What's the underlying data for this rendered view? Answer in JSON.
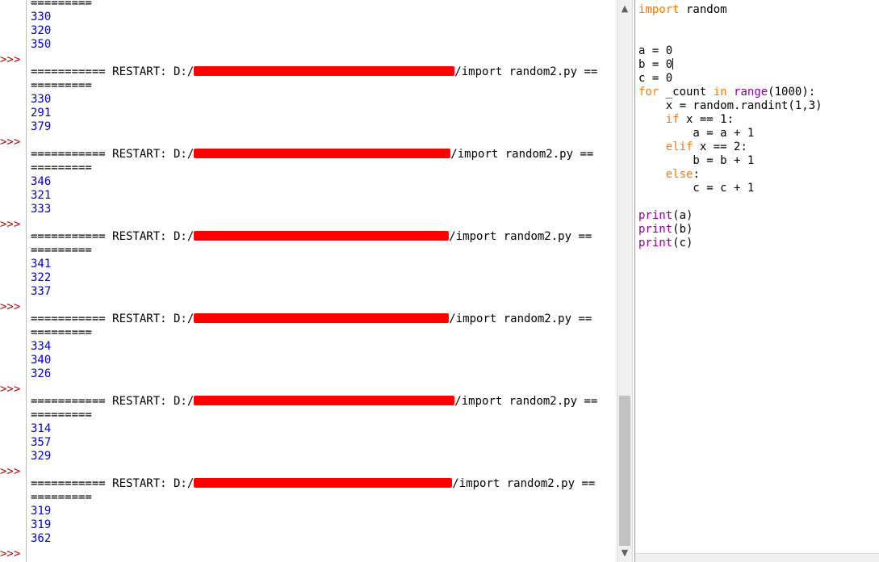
{
  "shell": {
    "prompt": ">>>",
    "top_partial": "=========",
    "first_outputs": [
      "330",
      "320",
      "350"
    ],
    "restart_line": "=========== RESTART: D:/",
    "restart_suffix": "/import random2.py ==",
    "restart_cont": "=========",
    "runs": [
      {
        "outputs": [
          "330",
          "291",
          "379"
        ]
      },
      {
        "outputs": [
          "346",
          "321",
          "333"
        ]
      },
      {
        "outputs": [
          "341",
          "322",
          "337"
        ]
      },
      {
        "outputs": [
          "334",
          "340",
          "326"
        ]
      },
      {
        "outputs": [
          "314",
          "357",
          "329"
        ]
      },
      {
        "outputs": [
          "319",
          "319",
          "362"
        ]
      }
    ]
  },
  "editor": {
    "lines": [
      {
        "kw": "import",
        "rest": " random"
      },
      {
        "rest": ""
      },
      {
        "rest": ""
      },
      {
        "rest": "a = 0"
      },
      {
        "rest": "b = 0",
        "caret": true
      },
      {
        "rest": "c = 0"
      },
      {
        "kw": "for",
        "rest": " _count ",
        "kw2": "in",
        "bi": " range",
        "tail": "(1000):"
      },
      {
        "rest": "    x = random.randint(1,3)"
      },
      {
        "indent": "    ",
        "kw": "if",
        "rest": " x == 1:"
      },
      {
        "rest": "        a = a + 1"
      },
      {
        "indent": "    ",
        "kw": "elif",
        "rest": " x == 2:"
      },
      {
        "rest": "        b = b + 1"
      },
      {
        "indent": "    ",
        "kw": "else",
        "rest": ":"
      },
      {
        "rest": "        c = c + 1"
      },
      {
        "rest": ""
      },
      {
        "bi": "print",
        "tail": "(a)"
      },
      {
        "bi": "print",
        "tail": "(b)"
      },
      {
        "bi": "print",
        "tail": "(c)"
      }
    ]
  },
  "scrollbar": {
    "up": "▲",
    "down": "▼"
  },
  "colors": {
    "prompt": "#c00000",
    "output": "#0000c0",
    "keyword": "#ff7700",
    "builtin": "#900090",
    "redaction": "#ff0000"
  }
}
